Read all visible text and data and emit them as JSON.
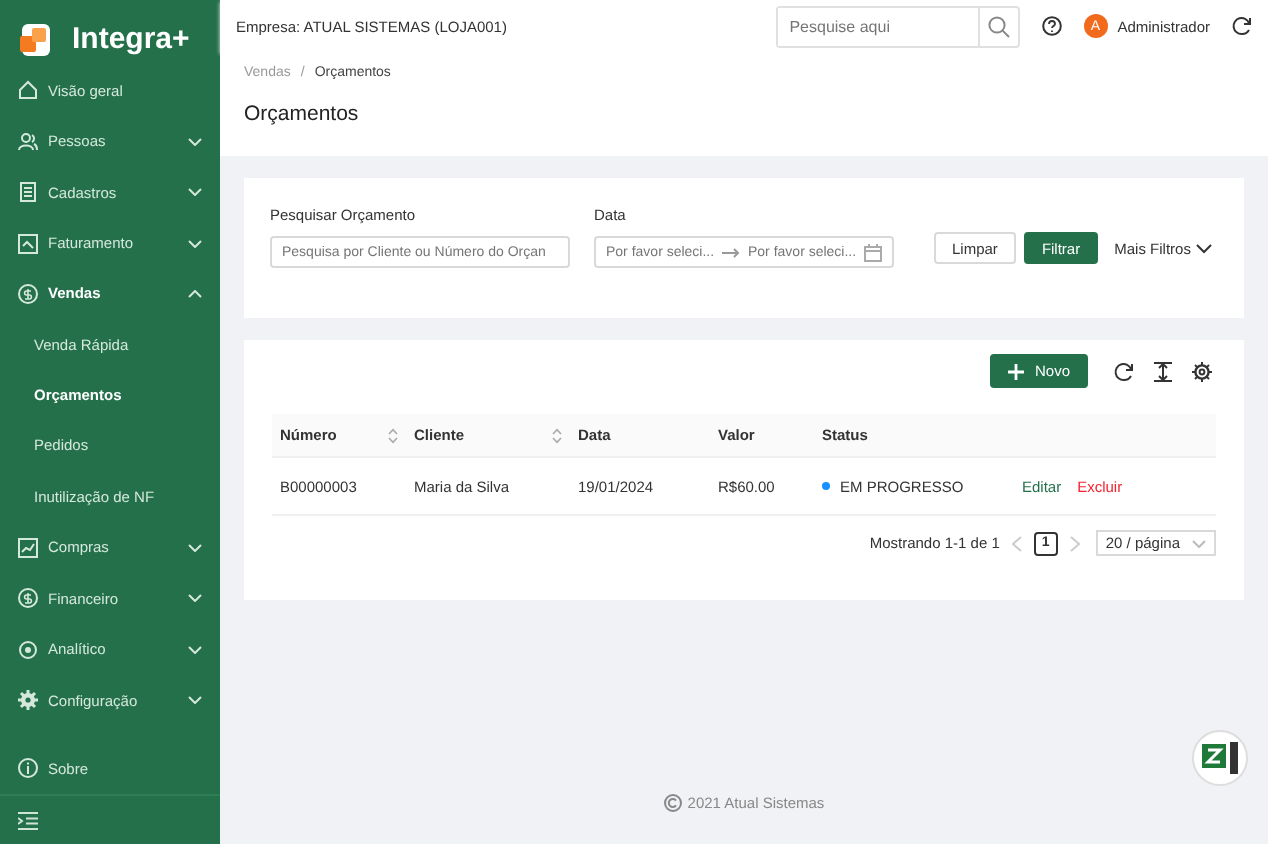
{
  "brand": {
    "name": "Integra+"
  },
  "sidebar": {
    "items": [
      {
        "label": "Visão geral",
        "expandable": false
      },
      {
        "label": "Pessoas",
        "expandable": true,
        "expanded": false
      },
      {
        "label": "Cadastros",
        "expandable": true,
        "expanded": false
      },
      {
        "label": "Faturamento",
        "expandable": true,
        "expanded": false
      },
      {
        "label": "Vendas",
        "expandable": true,
        "expanded": true,
        "children": [
          {
            "label": "Venda Rápida",
            "selected": false
          },
          {
            "label": "Orçamentos",
            "selected": true
          },
          {
            "label": "Pedidos",
            "selected": false
          },
          {
            "label": "Inutilização de NF",
            "selected": false
          }
        ]
      },
      {
        "label": "Compras",
        "expandable": true,
        "expanded": false
      },
      {
        "label": "Financeiro",
        "expandable": true,
        "expanded": false
      },
      {
        "label": "Analítico",
        "expandable": true,
        "expanded": false
      },
      {
        "label": "Configuração",
        "expandable": true,
        "expanded": false
      },
      {
        "label": "Sobre",
        "expandable": false
      }
    ]
  },
  "header": {
    "company_label": "Empresa:",
    "company": "ATUAL SISTEMAS (LOJA001)",
    "search": {
      "placeholder": "Pesquise aqui"
    },
    "user": {
      "initial": "A",
      "name": "Administrador"
    }
  },
  "breadcrumb": [
    "Vendas",
    "Orçamentos"
  ],
  "breadcrumb_separator": "/",
  "page_title": "Orçamentos",
  "filters": {
    "search": {
      "label": "Pesquisar Orçamento",
      "placeholder": "Pesquisa por Cliente ou Número do Orçan"
    },
    "date": {
      "label": "Data",
      "start_placeholder": "Por favor seleci...",
      "end_placeholder": "Por favor seleci..."
    },
    "buttons": [
      {
        "label": "Limpar",
        "kind": "default"
      },
      {
        "label": "Filtrar",
        "kind": "primary"
      }
    ],
    "more": "Mais Filtros"
  },
  "table": {
    "new_button": "Novo",
    "columns": [
      {
        "label": "Número",
        "sortable": true
      },
      {
        "label": "Cliente",
        "sortable": true
      },
      {
        "label": "Data",
        "sortable": false
      },
      {
        "label": "Valor",
        "sortable": false
      },
      {
        "label": "Status",
        "sortable": false
      }
    ],
    "rows": [
      {
        "numero": "B00000003",
        "cliente": "Maria da Silva",
        "data": "19/01/2024",
        "valor": "R$60.00",
        "status": "EM PROGRESSO",
        "color": "#1890ff",
        "actions": [
          "Editar",
          "Excluir"
        ]
      }
    ],
    "pagination": {
      "summary": "Mostrando 1-1 de 1",
      "pages": [
        {
          "label": "1",
          "selected": true
        }
      ],
      "page_size": "20 / página"
    }
  },
  "footer": "2021 Atual Sistemas"
}
